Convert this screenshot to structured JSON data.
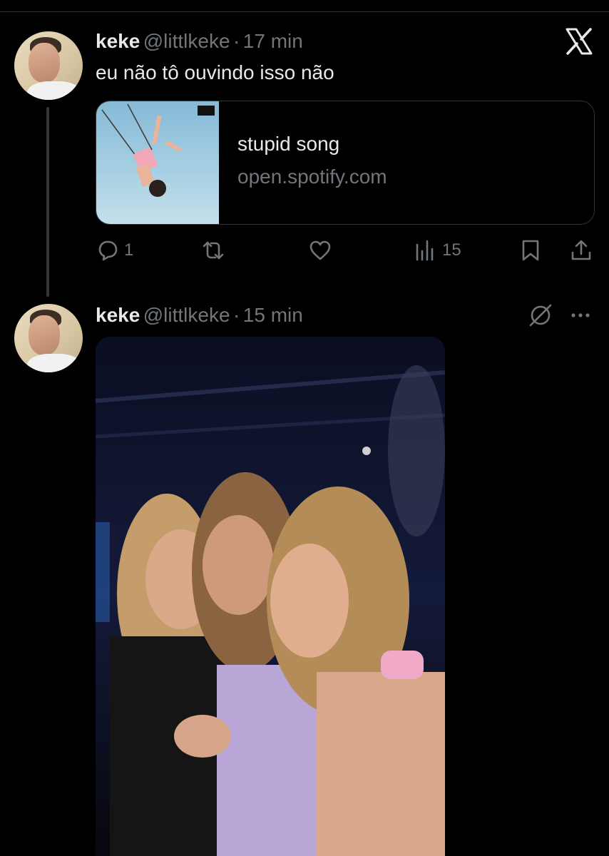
{
  "tweet1": {
    "name": "keke",
    "handle": "@littlkeke",
    "separator": "·",
    "time": "17 min",
    "text": "eu não tô ouvindo isso não",
    "card": {
      "title": "stupid song",
      "domain": "open.spotify.com"
    },
    "replies": "1",
    "retweets": "",
    "likes": "",
    "views": "15"
  },
  "tweet2": {
    "name": "keke",
    "handle": "@littlkeke",
    "separator": "·",
    "time": "15 min"
  },
  "icons": {
    "brand": "x-logo-icon",
    "reply": "reply-icon",
    "retweet": "retweet-icon",
    "like": "heart-icon",
    "views": "views-chart-icon",
    "bookmark": "bookmark-icon",
    "share": "share-icon",
    "grok": "grok-icon",
    "more": "more-icon"
  },
  "colors": {
    "background": "#000000",
    "text": "#e7e9ea",
    "muted": "#71767b",
    "border": "#2f3336"
  }
}
